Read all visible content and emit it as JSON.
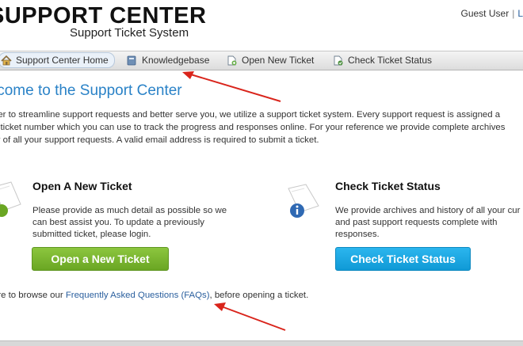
{
  "header": {
    "logo_title": "SUPPORT CENTER",
    "logo_subtitle": "Support Ticket System",
    "user_label": "Guest User",
    "separator": "|",
    "login_label": "L"
  },
  "nav": {
    "items": [
      {
        "label": "Support Center Home",
        "icon": "home-icon",
        "active": true
      },
      {
        "label": "Knowledgebase",
        "icon": "book-icon"
      },
      {
        "label": "Open New Ticket",
        "icon": "new-ticket-icon"
      },
      {
        "label": "Check Ticket Status",
        "icon": "ticket-status-icon"
      }
    ]
  },
  "main": {
    "welcome": "lcome to the Support Center",
    "intro_lines": [
      "der to streamline support requests and better serve you, we utilize a support ticket system. Every support request is assigned a",
      "e ticket number which you can use to track the progress and responses online. For your reference we provide complete archives",
      "ry of all your support requests. A valid email address is required to submit a ticket."
    ],
    "open_ticket": {
      "title": "Open A New Ticket",
      "lines": [
        "Please provide as much detail as possible so we",
        "can best assist you. To update a previously",
        "submitted ticket, please login."
      ],
      "button": "Open a New Ticket"
    },
    "check_status": {
      "title": "Check Ticket Status",
      "lines": [
        "We provide archives and history of all your cur",
        "and past support requests complete with",
        "responses."
      ],
      "button": "Check Ticket Status"
    },
    "faq_prefix": "ure to browse our ",
    "faq_link": "Frequently Asked Questions (FAQs)",
    "faq_suffix": ", before opening a ticket."
  },
  "colors": {
    "accent": "#2a82c7",
    "link": "#2a5f9e",
    "green_button": "#7cb82f",
    "blue_button": "#1aa7e2",
    "annotation_arrow": "#d9241b"
  }
}
